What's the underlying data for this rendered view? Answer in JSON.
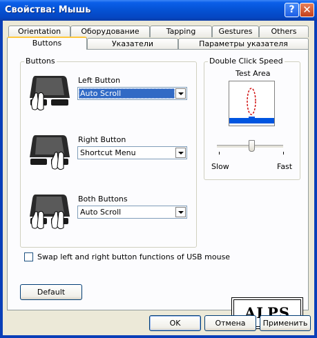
{
  "window": {
    "title": "Свойства: Мышь",
    "help_icon": "question-mark",
    "close_icon": "x"
  },
  "tabs_row1": [
    "Orientation",
    "Оборудование",
    "Tapping",
    "Gestures",
    "Others"
  ],
  "tabs_row2": [
    "Buttons",
    "Указатели",
    "Параметры указателя"
  ],
  "active_tab": "Buttons",
  "buttons_group": {
    "title": "Buttons",
    "left": {
      "label": "Left Button",
      "value": "Auto Scroll"
    },
    "right": {
      "label": "Right Button",
      "value": "Shortcut Menu"
    },
    "both": {
      "label": "Both Buttons",
      "value": "Auto Scroll"
    }
  },
  "double_click": {
    "title": "Double Click Speed",
    "test_area": "Test Area",
    "slow": "Slow",
    "fast": "Fast"
  },
  "swap_checkbox": {
    "label": "Swap left and right button functions of USB mouse",
    "checked": false
  },
  "default_button": "Default",
  "logo": "ALPS",
  "footer": {
    "ok": "OK",
    "cancel": "Отмена",
    "apply": "Применить"
  },
  "colors": {
    "titlebar": "#0553d6",
    "selection": "#316ac5",
    "tab_highlight": "#ffc83c",
    "test_band": "#0055e0",
    "close": "#c3401b"
  }
}
